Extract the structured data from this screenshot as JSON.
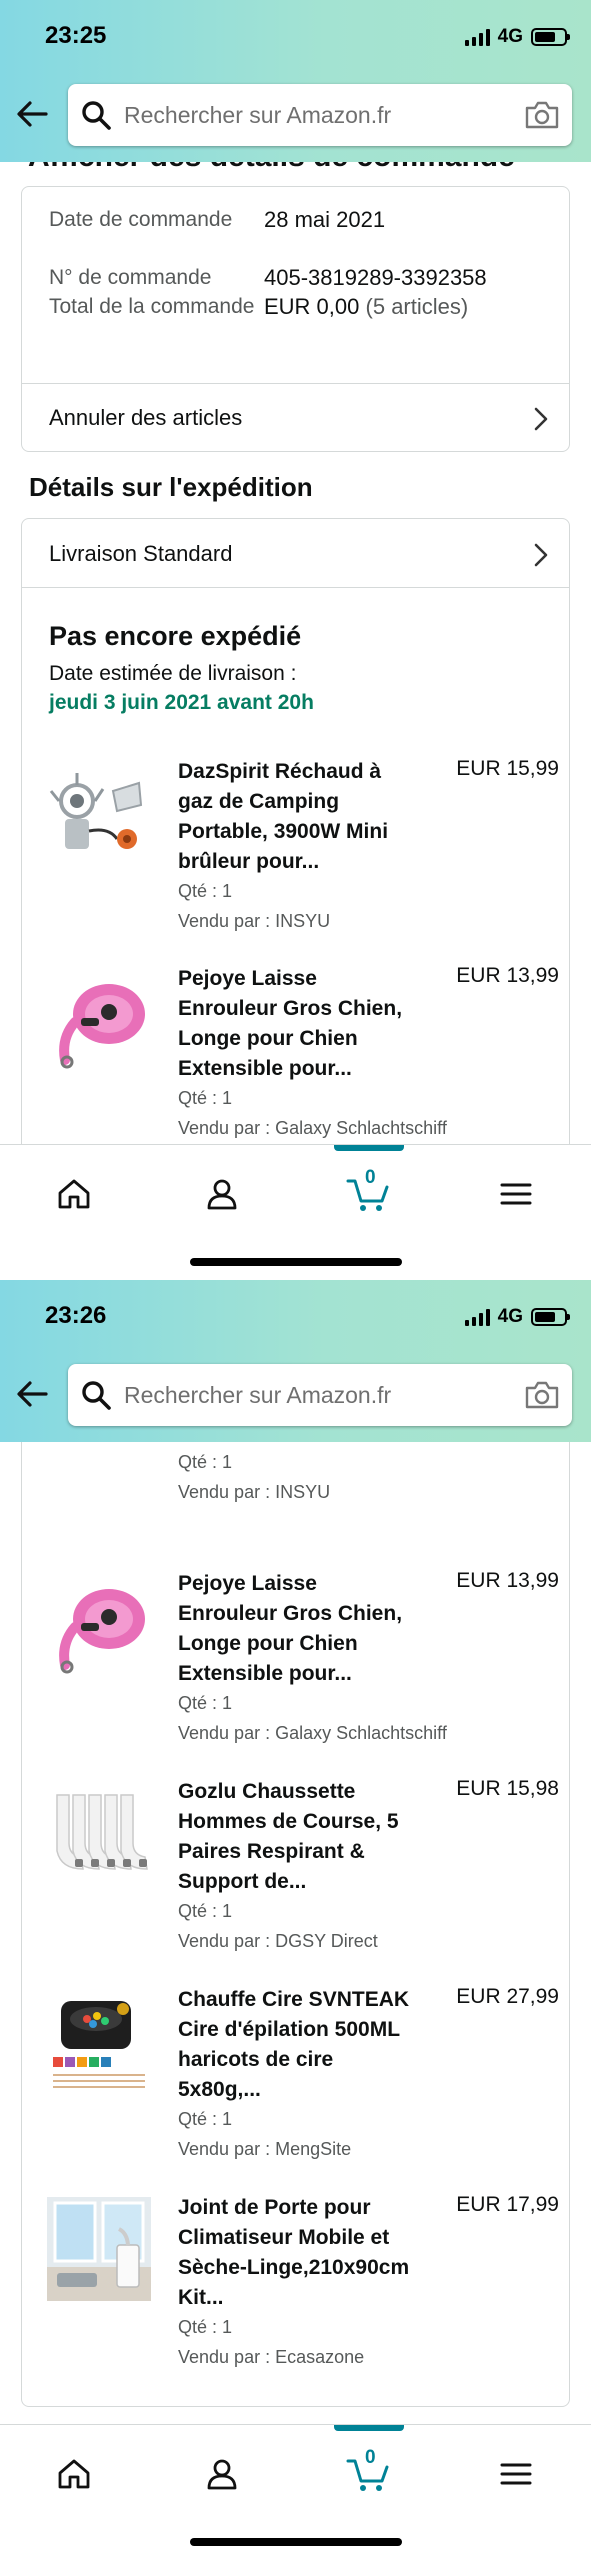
{
  "screen1": {
    "status": {
      "time": "23:25",
      "network": "4G"
    },
    "search": {
      "placeholder": "Rechercher sur Amazon.fr"
    },
    "partial_heading": "Afficher des détails de commande",
    "summary": {
      "rows": [
        {
          "label": "Date de commande",
          "value": "28 mai 2021",
          "extra": ""
        },
        {
          "label": "N° de commande",
          "value": "405-3819289-3392358",
          "extra": ""
        },
        {
          "label": "Total de la commande",
          "value": "EUR 0,00",
          "extra": "(5 articles)"
        }
      ],
      "cancel_label": "Annuler des articles"
    },
    "shipping": {
      "heading": "Détails sur l'expédition",
      "method": "Livraison Standard",
      "status": "Pas encore expédié",
      "est_label": "Date estimée de livraison :",
      "est_date": "jeudi 3 juin 2021 avant 20h"
    },
    "items": [
      {
        "title": "DazSpirit Réchaud à gaz de Camping Portable, 3900W Mini brûleur pour...",
        "price": "EUR 15,99",
        "qty": "Qté : 1",
        "seller": "Vendu par : INSYU",
        "thumb": "camping-stove"
      },
      {
        "title": "Pejoye Laisse Enrouleur Gros Chien, Longe pour Chien Extensible pour...",
        "price": "EUR 13,99",
        "qty": "Qté : 1",
        "seller": "Vendu par : Galaxy Schlachtschiff",
        "thumb": "pink-dog-leash"
      }
    ],
    "nav": {
      "cart_count": "0"
    }
  },
  "screen2": {
    "status": {
      "time": "23:26",
      "network": "4G"
    },
    "search": {
      "placeholder": "Rechercher sur Amazon.fr"
    },
    "partial_item": {
      "qty": "Qté : 1",
      "seller": "Vendu par : INSYU"
    },
    "items": [
      {
        "title": "Pejoye Laisse Enrouleur Gros Chien, Longe pour Chien Extensible pour...",
        "price": "EUR 13,99",
        "qty": "Qté : 1",
        "seller": "Vendu par : Galaxy Schlachtschiff",
        "thumb": "pink-dog-leash"
      },
      {
        "title": "Gozlu Chaussette Hommes de Course, 5 Paires Respirant & Support de...",
        "price": "EUR 15,98",
        "qty": "Qté : 1",
        "seller": "Vendu par : DGSY Direct",
        "thumb": "white-socks"
      },
      {
        "title": "Chauffe Cire SVNTEAK Cire d'épilation 500ML haricots de cire 5x80g,...",
        "price": "EUR 27,99",
        "qty": "Qté : 1",
        "seller": "Vendu par : MengSite",
        "thumb": "wax-heater-kit"
      },
      {
        "title": "Joint de Porte pour Climatiseur Mobile et Sèche-Linge,210x90cm Kit...",
        "price": "EUR 17,99",
        "qty": "Qté : 1",
        "seller": "Vendu par : Ecasazone",
        "thumb": "air-conditioner-room"
      }
    ],
    "nav": {
      "cart_count": "0"
    }
  },
  "colors": {
    "accent": "#008296",
    "delivery_green": "#067d62",
    "header_start": "#84d8e3",
    "header_end": "#a9e4cb"
  }
}
